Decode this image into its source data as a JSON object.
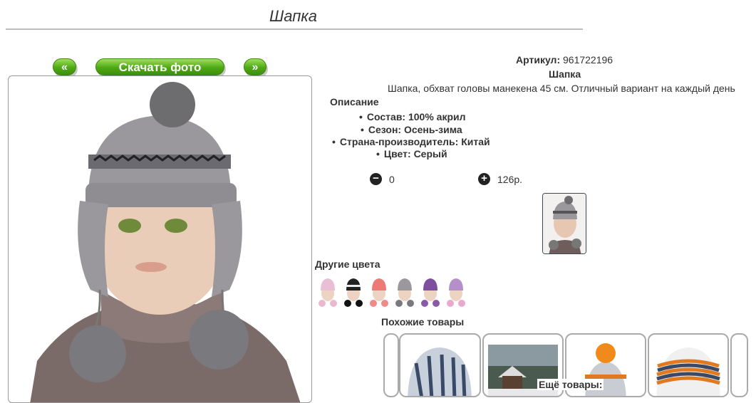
{
  "page": {
    "title": "Шапка"
  },
  "nav": {
    "prev_label": "«",
    "download_label": "Скачать фото",
    "next_label": "»"
  },
  "product": {
    "article_label": "Артикул:",
    "article_value": "961722196",
    "name": "Шапка",
    "description": "Шапка, обхват головы манекена 45 см. Отличный вариант на каждый день",
    "description_heading": "Описание",
    "attributes": [
      "Состав: 100% акрил",
      "Сезон: Осень-зима",
      "Страна-производитель: Китай",
      "Цвет: Серый"
    ],
    "quantity": "0",
    "price": "126р."
  },
  "icons": {
    "minus": "minus-circle-icon",
    "plus": "plus-circle-icon"
  },
  "other_colors": {
    "heading": "Другие цвета",
    "swatches": [
      "pink",
      "black",
      "coral",
      "grey",
      "purple",
      "lilac"
    ]
  },
  "similar": {
    "heading": "Похожие товары"
  },
  "more": {
    "label": "Ещё товары:"
  },
  "colors": {
    "button_green": "#4ea814",
    "hat_grey": "#9a989c"
  }
}
